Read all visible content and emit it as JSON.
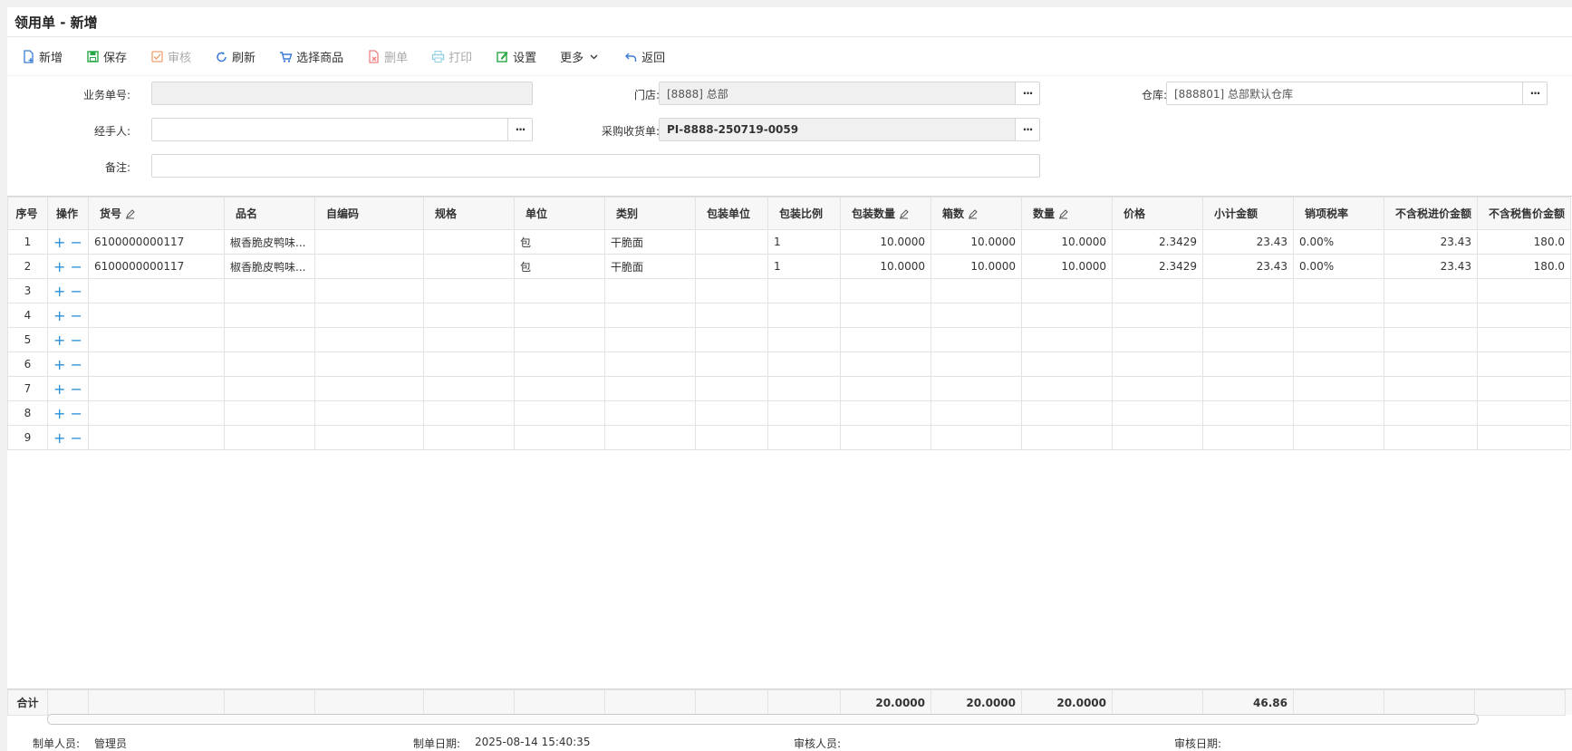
{
  "title": "领用单 - 新增",
  "toolbar": [
    {
      "label": "新增",
      "icon": "new-doc-icon",
      "color": "#3a7bd5",
      "disabled": false
    },
    {
      "label": "保存",
      "icon": "save-icon",
      "color": "#27a745",
      "disabled": false
    },
    {
      "label": "审核",
      "icon": "check-icon",
      "color": "#f0a070",
      "disabled": true
    },
    {
      "label": "刷新",
      "icon": "refresh-icon",
      "color": "#3a7bd5",
      "disabled": false
    },
    {
      "label": "选择商品",
      "icon": "cart-icon",
      "color": "#3a7bd5",
      "disabled": false
    },
    {
      "label": "删单",
      "icon": "delete-doc-icon",
      "color": "#f08080",
      "disabled": true
    },
    {
      "label": "打印",
      "icon": "print-icon",
      "color": "#8fd0e0",
      "disabled": true
    },
    {
      "label": "设置",
      "icon": "settings-icon",
      "color": "#27a745",
      "disabled": false
    },
    {
      "label": "更多",
      "icon": "chevron-down-icon",
      "color": "#333333",
      "disabled": false
    },
    {
      "label": "返回",
      "icon": "back-icon",
      "color": "#3a7bd5",
      "disabled": false
    }
  ],
  "form": {
    "order_no": {
      "label": "业务单号:",
      "value": ""
    },
    "store": {
      "label": "门店:",
      "value": "[8888] 总部"
    },
    "warehouse": {
      "label": "仓库:",
      "value": "[888801] 总部默认仓库"
    },
    "handler": {
      "label": "经手人:",
      "value": ""
    },
    "purchase_receipt": {
      "label": "采购收货单:",
      "value": "PI-8888-250719-0059"
    },
    "remark": {
      "label": "备注:",
      "value": ""
    }
  },
  "grid": {
    "columns": [
      "序号",
      "操作",
      "货号",
      "品名",
      "自编码",
      "规格",
      "单位",
      "类别",
      "包装单位",
      "包装比例",
      "包装数量",
      "箱数",
      "数量",
      "价格",
      "小计金额",
      "销项税率",
      "不含税进价金额",
      "不含税售价金额"
    ],
    "rows": [
      {
        "seq": "1",
        "sku": "6100000000117",
        "name": "椒香脆皮鸭味...",
        "code": "",
        "spec": "",
        "unit": "包",
        "category": "干脆面",
        "pack_unit": "",
        "pack_ratio": "1",
        "pack_qty": "10.0000",
        "boxes": "10.0000",
        "qty": "10.0000",
        "price": "2.3429",
        "subtotal": "23.43",
        "tax_rate": "0.00%",
        "cost_ex_tax": "23.43",
        "sale_ex_tax": "180.0"
      },
      {
        "seq": "2",
        "sku": "6100000000117",
        "name": "椒香脆皮鸭味...",
        "code": "",
        "spec": "",
        "unit": "包",
        "category": "干脆面",
        "pack_unit": "",
        "pack_ratio": "1",
        "pack_qty": "10.0000",
        "boxes": "10.0000",
        "qty": "10.0000",
        "price": "2.3429",
        "subtotal": "23.43",
        "tax_rate": "0.00%",
        "cost_ex_tax": "23.43",
        "sale_ex_tax": "180.0"
      },
      {
        "seq": "3"
      },
      {
        "seq": "4"
      },
      {
        "seq": "5"
      },
      {
        "seq": "6"
      },
      {
        "seq": "7"
      },
      {
        "seq": "8"
      },
      {
        "seq": "9"
      }
    ],
    "ops_plus": "+",
    "ops_minus": "−",
    "totals": {
      "label": "合计",
      "pack_qty": "20.0000",
      "boxes": "20.0000",
      "qty": "20.0000",
      "subtotal": "46.86"
    }
  },
  "footer": {
    "creator_label": "制单人员:",
    "creator": "管理员",
    "created_label": "制单日期:",
    "created": "2025-08-14 15:40:35",
    "auditor_label": "审核人员:",
    "auditor": "",
    "audit_date_label": "审核日期:",
    "audit_date": ""
  }
}
